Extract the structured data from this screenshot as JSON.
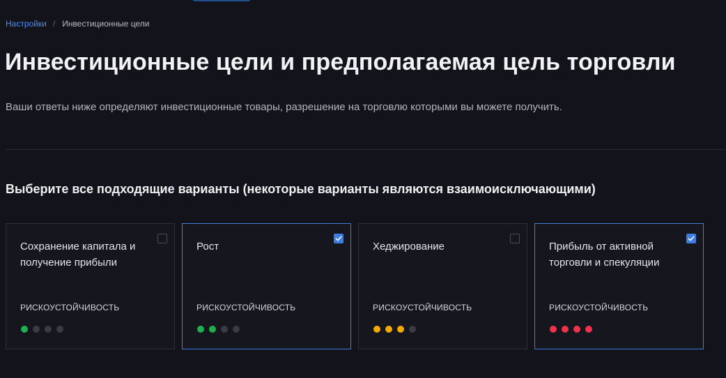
{
  "breadcrumb": {
    "link": "Настройки",
    "separator": "/",
    "current": "Инвестиционные цели"
  },
  "page": {
    "title": "Инвестиционные цели и предполагаемая цель торговли",
    "description": "Ваши ответы ниже определяют инвестиционные товары, разрешение на торговлю которыми вы можете получить."
  },
  "section": {
    "title": "Выберите все подходящие варианты (некоторые варианты являются взаимоисключающими)"
  },
  "colors": {
    "accent": "#3d7ee0",
    "risk_green": "#1fb14f",
    "risk_orange": "#f2a900",
    "risk_red": "#f0334b",
    "risk_empty": "#3a3c45"
  },
  "cards": [
    {
      "title": "Сохранение капитала и получение прибыли",
      "selected": false,
      "risk_label": "РИСКОУСТОЙЧИВОСТЬ",
      "risk_level": 1,
      "risk_color": "#1fb14f"
    },
    {
      "title": "Рост",
      "selected": true,
      "risk_label": "РИСКОУСТОЙЧИВОСТЬ",
      "risk_level": 2,
      "risk_color": "#1fb14f"
    },
    {
      "title": "Хеджирование",
      "selected": false,
      "risk_label": "РИСКОУСТОЙЧИВОСТЬ",
      "risk_level": 3,
      "risk_color": "#f2a900"
    },
    {
      "title": "Прибыль от активной торговли и спекуляции",
      "selected": true,
      "risk_label": "РИСКОУСТОЙЧИВОСТЬ",
      "risk_level": 4,
      "risk_color": "#f0334b"
    }
  ]
}
